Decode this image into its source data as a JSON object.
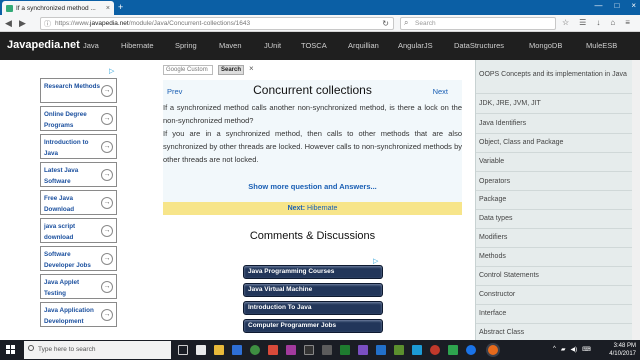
{
  "browser": {
    "tab_title": "If a synchronized method ...",
    "tab_close": "×",
    "new_tab": "+",
    "window_controls": [
      "—",
      "□",
      "×"
    ],
    "url_prefix": "https://www.",
    "url_host": "javapedia.net",
    "url_path": "/module/Java/Concurrent-collections/1643",
    "search_placeholder": "Search"
  },
  "header": {
    "logo": "Javapedia.net",
    "menu": [
      "Java",
      "Hibernate",
      "Spring",
      "Maven",
      "JUnit",
      "TOSCA",
      "Arquillian",
      "AngularJS",
      "DataStructures",
      "MongoDB",
      "MuleESB"
    ]
  },
  "sidebar_links": [
    "Research Methods",
    "Online Degree Programs",
    "Introduction to Java",
    "Latest Java Software",
    "Free Java Download",
    "java script download",
    "Software Developer Jobs",
    "Java Applet Testing",
    "Java Application Development"
  ],
  "search": {
    "placeholder": "Google  Custom",
    "button": "Search",
    "close": "×"
  },
  "content": {
    "title": "Concurrent collections",
    "prev": "Prev",
    "next": "Next",
    "question": "If a synchronized method calls another non-synchronized method, is there a lock on the non-synchronized method?",
    "answer": "If you are in a synchronized method, then calls to other methods that are also synchronized by other threads are locked. However calls to non-synchronized methods by other threads are not locked.",
    "show_more": "Show more question and Answers...",
    "next_label": "Next:",
    "next_value": "Hibernate",
    "comments_title": "Comments & Discussions"
  },
  "ad_buttons": [
    "Java Programming Courses",
    "Java Virtual Machine",
    "Introduction To Java",
    "Computer Programmer Jobs"
  ],
  "right_sidebar": [
    "OOPS Concepts and its implementation in Java",
    "JDK, JRE, JVM, JIT",
    "Java Identifiers",
    "Object, Class and Package",
    "Variable",
    "Operators",
    "Package",
    "Data types",
    "Modifiers",
    "Methods",
    "Control Statements",
    "Constructor",
    "Interface",
    "Abstract Class"
  ],
  "taskbar": {
    "search_placeholder": "Type here to search",
    "time": "3:48 PM",
    "date": "4/10/2017"
  },
  "colors": {
    "accent_link": "#1a5fb4",
    "header_bg": "#1f1f1f",
    "next_bar": "#f7e58a",
    "ad_button": "#22365a"
  }
}
